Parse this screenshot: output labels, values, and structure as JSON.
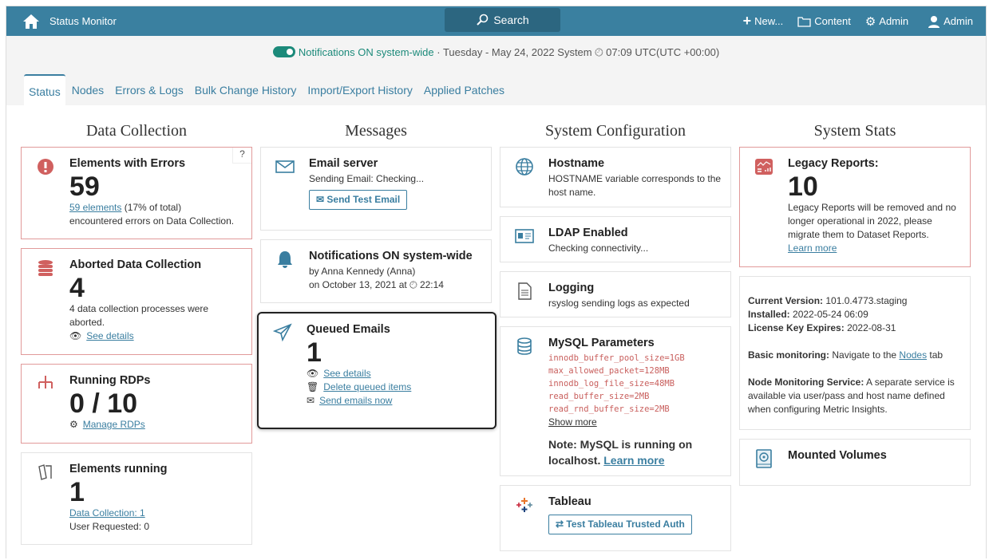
{
  "topbar": {
    "title": "Status Monitor",
    "search": "Search",
    "new": "New...",
    "content": "Content",
    "admin_gear": "Admin",
    "admin_user": "Admin"
  },
  "status_line": {
    "notifications": "Notifications ON system-wide",
    "date": "· Tuesday - May 24, 2022 System",
    "time": "07:09 UTC(UTC +00:00)"
  },
  "tabs": [
    "Status",
    "Nodes",
    "Errors & Logs",
    "Bulk Change History",
    "Import/Export History",
    "Applied Patches"
  ],
  "columns": {
    "c1": "Data Collection",
    "c2": "Messages",
    "c3": "System Configuration",
    "c4": "System Stats"
  },
  "data_collection": {
    "errors": {
      "title": "Elements with Errors",
      "value": "59",
      "link": "59 elements",
      "text1": " (17% of total)",
      "text2": "encountered errors on Data Collection.",
      "help": "?"
    },
    "aborted": {
      "title": "Aborted Data Collection",
      "value": "4",
      "text": "4 data collection processes were aborted.",
      "link": "See details"
    },
    "rdps": {
      "title": "Running RDPs",
      "value": "0 / 10",
      "link": "Manage RDPs"
    },
    "running": {
      "title": "Elements running",
      "value": "1",
      "link": "Data Collection: 1",
      "text": "User Requested: 0"
    }
  },
  "messages": {
    "email": {
      "title": "Email server",
      "text": "Sending Email: Checking...",
      "button": "Send Test Email"
    },
    "notif": {
      "title": "Notifications ON system-wide",
      "by": "by Anna Kennedy (Anna)",
      "on": "on October 13, 2021 at",
      "time": "22:14"
    },
    "queued": {
      "title": "Queued Emails",
      "value": "1",
      "l1": "See details",
      "l2": "Delete queued items",
      "l3": "Send emails now"
    }
  },
  "sysconfig": {
    "hostname": {
      "title": "Hostname",
      "text": "HOSTNAME variable corresponds to the host name."
    },
    "ldap": {
      "title": "LDAP Enabled",
      "text": "Checking connectivity..."
    },
    "logging": {
      "title": "Logging",
      "text": "rsyslog sending logs as expected"
    },
    "mysql": {
      "title": "MySQL Parameters",
      "params": [
        "innodb_buffer_pool_size=1GB",
        "max_allowed_packet=128MB",
        "innodb_log_file_size=48MB",
        "read_buffer_size=2MB",
        "read_rnd_buffer_size=2MB"
      ],
      "show_more": "Show more",
      "note": "Note: MySQL is running on localhost.",
      "learn": "Learn more"
    },
    "tableau": {
      "title": "Tableau",
      "button": "Test Tableau Trusted Auth"
    }
  },
  "stats": {
    "legacy": {
      "title": "Legacy Reports:",
      "value": "10",
      "text": "Legacy Reports will be removed and no longer operational in 2022, please migrate them to Dataset Reports.",
      "link": "Learn more"
    },
    "info": {
      "ver_l": "Current Version:",
      "ver": " 101.0.4773.staging",
      "inst_l": "Installed:",
      "inst": " 2022-05-24 06:09",
      "lic_l": "License Key Expires:",
      "lic": " 2022-08-31",
      "basic_l": "Basic monitoring:",
      "basic": " Navigate to the ",
      "nodes": "Nodes",
      "tab": " tab",
      "nms_l": "Node Monitoring Service:",
      "nms": " A separate service is available via user/pass and host name defined when configuring Metric Insights."
    },
    "volumes": {
      "title": "Mounted Volumes"
    }
  }
}
